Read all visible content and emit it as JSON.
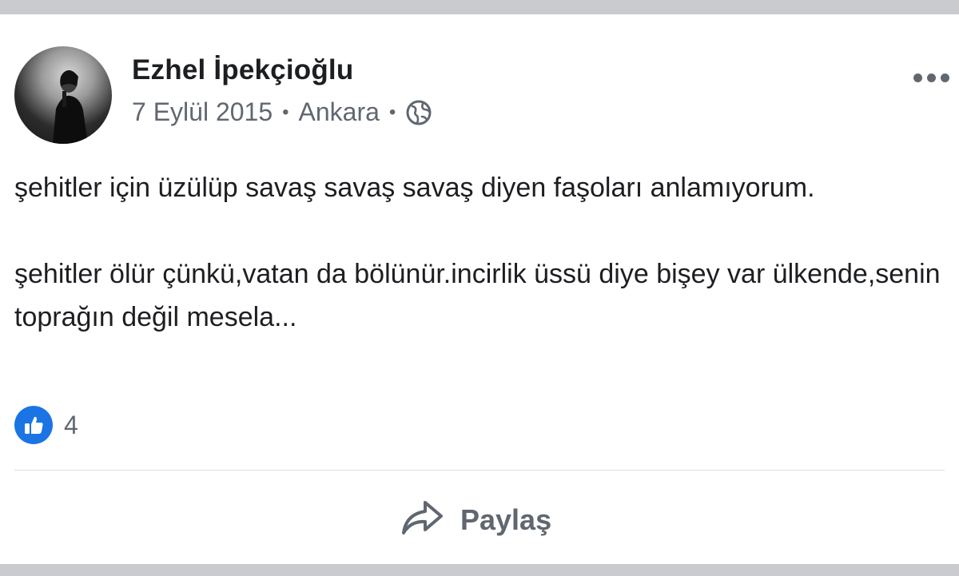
{
  "post": {
    "author": "Ezhel İpekçioğlu",
    "date": "7 Eylül 2015",
    "location": "Ankara",
    "separator": "•",
    "audience_icon": "globe-icon",
    "paragraphs": [
      "şehitler için üzülüp savaş savaş savaş diyen faşoları anlamıyorum.",
      "şehitler ölür çünkü,vatan da bölünür.incirlik üssü diye bişey var ülkende,senin toprağın değil mesela..."
    ],
    "reactions": {
      "icon": "thumbs-up-icon",
      "count": "4"
    },
    "actions": {
      "share_label": "Paylaş",
      "share_icon": "share-arrow-icon"
    },
    "more_icon": "more-options-icon"
  },
  "colors": {
    "like_blue": "#1b74e4",
    "text": "#1c1e21",
    "muted": "#606770"
  }
}
